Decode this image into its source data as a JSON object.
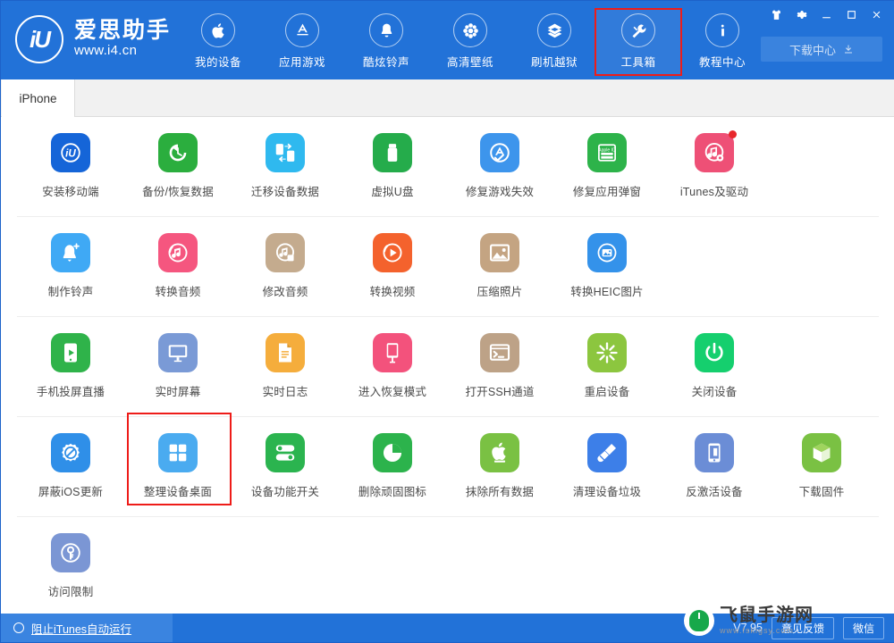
{
  "brand": {
    "logo_text": "iU",
    "name": "爱思助手",
    "url": "www.i4.cn"
  },
  "header": {
    "nav_items": [
      {
        "label": "我的设备",
        "icon": "apple-icon"
      },
      {
        "label": "应用游戏",
        "icon": "appstore-icon"
      },
      {
        "label": "酷炫铃声",
        "icon": "bell-icon"
      },
      {
        "label": "高清壁纸",
        "icon": "flower-icon"
      },
      {
        "label": "刷机越狱",
        "icon": "box-open-icon"
      },
      {
        "label": "工具箱",
        "icon": "wrench-icon",
        "highlighted": true
      },
      {
        "label": "教程中心",
        "icon": "info-icon"
      }
    ],
    "window_controls": [
      {
        "name": "shirt-icon"
      },
      {
        "name": "gear-icon"
      },
      {
        "name": "minimize-icon"
      },
      {
        "name": "maximize-icon"
      },
      {
        "name": "close-icon"
      }
    ],
    "download_center_label": "下载中心"
  },
  "tabs": [
    {
      "label": "iPhone",
      "active": true
    }
  ],
  "toolbox": {
    "rows": [
      [
        {
          "label": "安装移动端",
          "icon": "i4-app-icon",
          "color": "#1565d8"
        },
        {
          "label": "备份/恢复数据",
          "icon": "clock-restore-icon",
          "color": "#2bae3e"
        },
        {
          "label": "迁移设备数据",
          "icon": "device-transfer-icon",
          "color": "#2fb9ef"
        },
        {
          "label": "虚拟U盘",
          "icon": "usb-drive-icon",
          "color": "#25ac4b"
        },
        {
          "label": "修复游戏失效",
          "icon": "appstore-fix-icon",
          "color": "#3d95ec"
        },
        {
          "label": "修复应用弹窗",
          "icon": "appleid-icon",
          "color": "#2db34a"
        },
        {
          "label": "iTunes及驱动",
          "icon": "itunes-icon",
          "color": "#ee5076",
          "badge": true
        }
      ],
      [
        {
          "label": "制作铃声",
          "icon": "bell-plus-icon",
          "color": "#3fa9f5"
        },
        {
          "label": "转换音频",
          "icon": "audio-convert-icon",
          "color": "#f5567f"
        },
        {
          "label": "修改音频",
          "icon": "audio-edit-icon",
          "color": "#c4ab8e"
        },
        {
          "label": "转换视频",
          "icon": "video-convert-icon",
          "color": "#f4622d"
        },
        {
          "label": "压缩照片",
          "icon": "photo-compress-icon",
          "color": "#c4a482"
        },
        {
          "label": "转换HEIC图片",
          "icon": "heic-convert-icon",
          "color": "#3492ea"
        }
      ],
      [
        {
          "label": "手机投屏直播",
          "icon": "screen-cast-icon",
          "color": "#2fb34a"
        },
        {
          "label": "实时屏幕",
          "icon": "monitor-icon",
          "color": "#7a9ad6"
        },
        {
          "label": "实时日志",
          "icon": "document-log-icon",
          "color": "#f5ad3c"
        },
        {
          "label": "进入恢复模式",
          "icon": "recovery-mode-icon",
          "color": "#f3527c"
        },
        {
          "label": "打开SSH通道",
          "icon": "terminal-icon",
          "color": "#bda287"
        },
        {
          "label": "重启设备",
          "icon": "restart-icon",
          "color": "#8cc63f"
        },
        {
          "label": "关闭设备",
          "icon": "power-off-icon",
          "color": "#15cf6e"
        }
      ],
      [
        {
          "label": "屏蔽iOS更新",
          "icon": "block-update-icon",
          "color": "#2f8fe8"
        },
        {
          "label": "整理设备桌面",
          "icon": "grid-apps-icon",
          "color": "#4aabf0",
          "boxed": true
        },
        {
          "label": "设备功能开关",
          "icon": "toggles-icon",
          "color": "#2bb44f"
        },
        {
          "label": "删除顽固图标",
          "icon": "pie-clock-icon",
          "color": "#2cb34c"
        },
        {
          "label": "抹除所有数据",
          "icon": "apple-erase-icon",
          "color": "#7ac143"
        },
        {
          "label": "清理设备垃圾",
          "icon": "broom-icon",
          "color": "#3d7fe8"
        },
        {
          "label": "反激活设备",
          "icon": "deactivate-icon",
          "color": "#6b8dd6"
        },
        {
          "label": "下载固件",
          "icon": "firmware-box-icon",
          "color": "#7ac143"
        }
      ],
      [
        {
          "label": "访问限制",
          "icon": "key-lock-icon",
          "color": "#7b96d4"
        }
      ]
    ]
  },
  "statusbar": {
    "block_itunes_label": "阻止iTunes自动运行",
    "version": "V7.95",
    "buttons": [
      {
        "label": "意见反馈"
      },
      {
        "label": "微信"
      }
    ]
  },
  "watermark": {
    "main": "飞鼠手游网",
    "sub": "www.fskigsy.com"
  },
  "colors": {
    "header_blue": "#2272d8",
    "highlight_red": "#ee1c19",
    "badge_red": "#e8272b"
  }
}
